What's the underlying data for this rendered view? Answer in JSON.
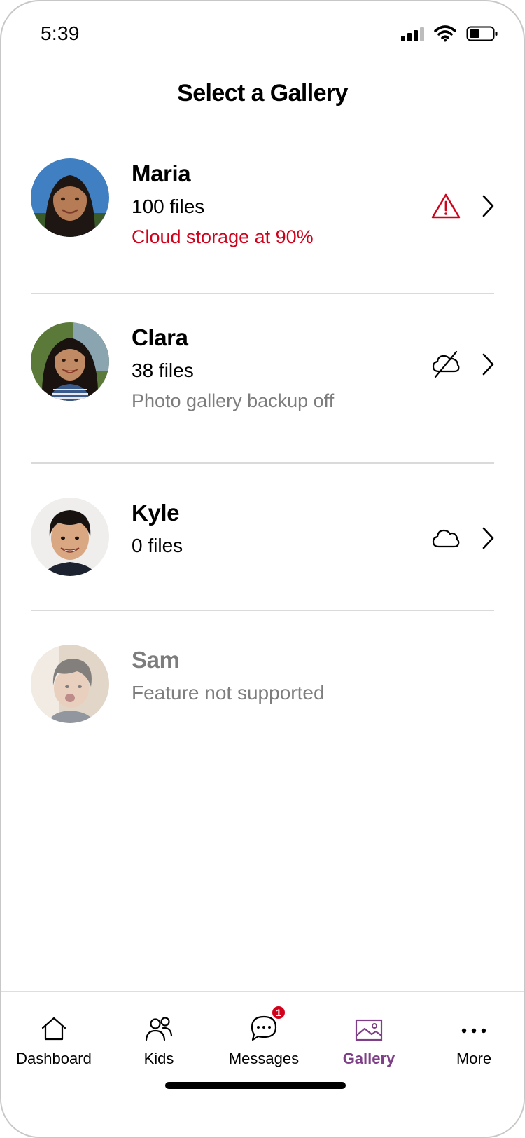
{
  "status_bar": {
    "time": "5:39"
  },
  "header": {
    "title": "Select a Gallery"
  },
  "kids": [
    {
      "name": "Maria",
      "files": "100 files",
      "status": "Cloud storage at 90%",
      "status_type": "alert",
      "icon": "warning-icon"
    },
    {
      "name": "Clara",
      "files": "38 files",
      "status": "Photo gallery backup off",
      "status_type": "muted",
      "icon": "cloud-off-icon"
    },
    {
      "name": "Kyle",
      "files": "0 files",
      "icon": "cloud-icon"
    },
    {
      "name": "Sam",
      "status": "Feature not supported",
      "status_type": "disabled"
    }
  ],
  "tab_bar": {
    "tabs": [
      {
        "label": "Dashboard",
        "icon": "home-icon"
      },
      {
        "label": "Kids",
        "icon": "people-icon"
      },
      {
        "label": "Messages",
        "icon": "chat-icon",
        "badge": "1"
      },
      {
        "label": "Gallery",
        "icon": "image-icon",
        "active": true
      },
      {
        "label": "More",
        "icon": "more-icon"
      }
    ]
  },
  "colors": {
    "alert": "#d0021b",
    "active_tab": "#7f3f88",
    "muted_text": "#7d7d7d",
    "divider": "#dadada"
  }
}
